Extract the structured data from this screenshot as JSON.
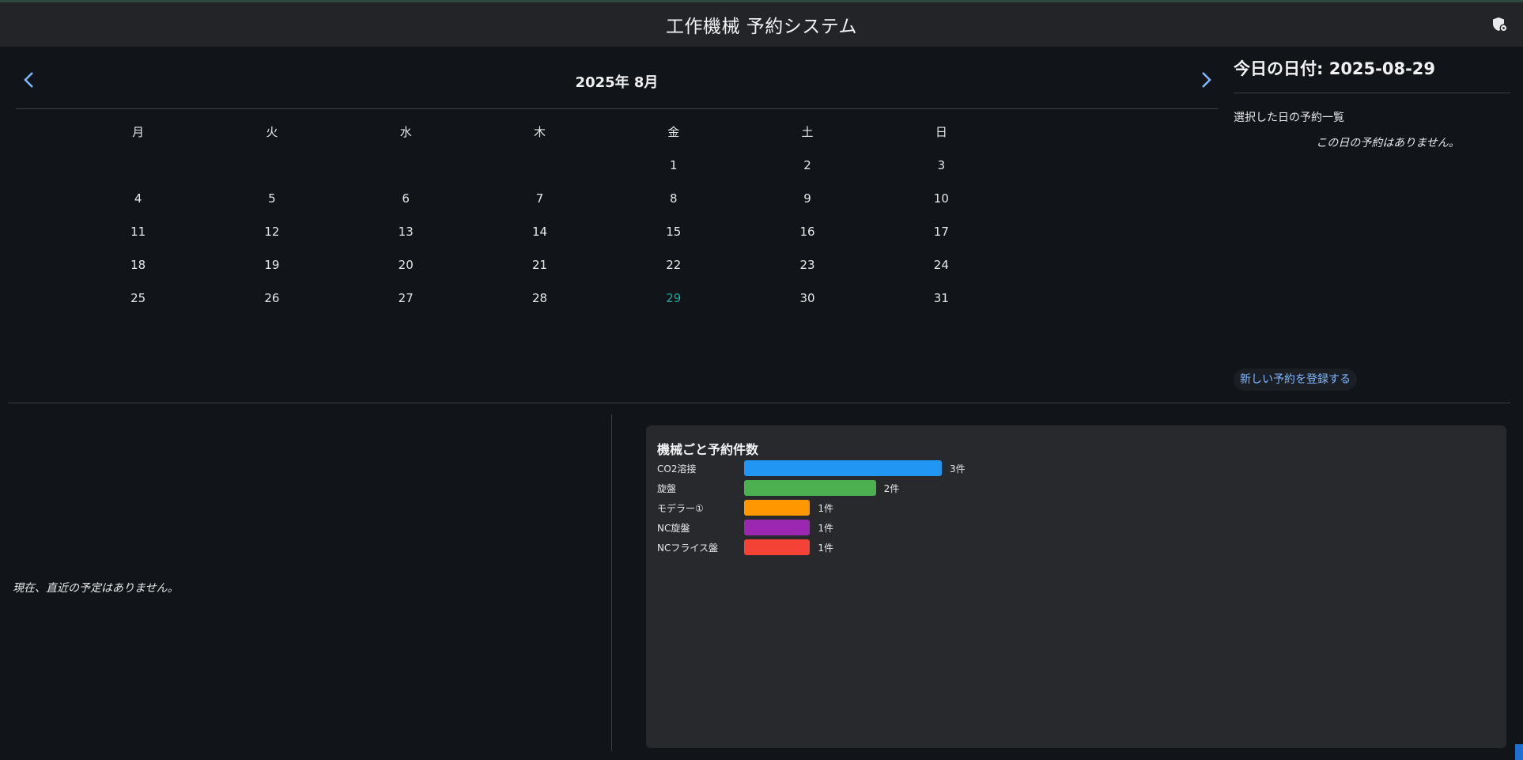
{
  "header": {
    "title": "工作機械 予約システム",
    "admin_icon": "shield-gear-icon"
  },
  "calendar": {
    "month_title": "2025年 8月",
    "prev_icon": "chevron-left-icon",
    "next_icon": "chevron-right-icon",
    "weekdays": [
      "月",
      "火",
      "水",
      "木",
      "金",
      "土",
      "日"
    ],
    "weeks": [
      [
        "",
        "",
        "",
        "",
        "1",
        "2",
        "3"
      ],
      [
        "4",
        "5",
        "6",
        "7",
        "8",
        "9",
        "10"
      ],
      [
        "11",
        "12",
        "13",
        "14",
        "15",
        "16",
        "17"
      ],
      [
        "18",
        "19",
        "20",
        "21",
        "22",
        "23",
        "24"
      ],
      [
        "25",
        "26",
        "27",
        "28",
        "29",
        "30",
        "31"
      ]
    ],
    "today_day": "29",
    "accent_color": "#1fa89a"
  },
  "side": {
    "today_label": "今日の日付: 2025-08-29",
    "selected_title": "選択した日の予約一覧",
    "no_reservations": "この日の予約はありません。",
    "new_button": "新しい予約を登録する"
  },
  "upcoming": {
    "empty_text": "現在、直近の予定はありません。"
  },
  "chart": {
    "title": "機械ごと予約件数",
    "rows": [
      {
        "label": "CO2溶接",
        "count_label": "3件",
        "color": "#2196f3"
      },
      {
        "label": "旋盤",
        "count_label": "2件",
        "color": "#4caf50"
      },
      {
        "label": "モデラー①",
        "count_label": "1件",
        "color": "#ff9800"
      },
      {
        "label": "NC旋盤",
        "count_label": "1件",
        "color": "#9c27b0"
      },
      {
        "label": "NCフライス盤",
        "count_label": "1件",
        "color": "#f44336"
      }
    ]
  },
  "chart_data": {
    "type": "bar",
    "title": "機械ごと予約件数",
    "categories": [
      "CO2溶接",
      "旋盤",
      "モデラー①",
      "NC旋盤",
      "NCフライス盤"
    ],
    "values": [
      3,
      2,
      1,
      1,
      1
    ],
    "colors": [
      "#2196f3",
      "#4caf50",
      "#ff9800",
      "#9c27b0",
      "#f44336"
    ],
    "orientation": "horizontal"
  }
}
